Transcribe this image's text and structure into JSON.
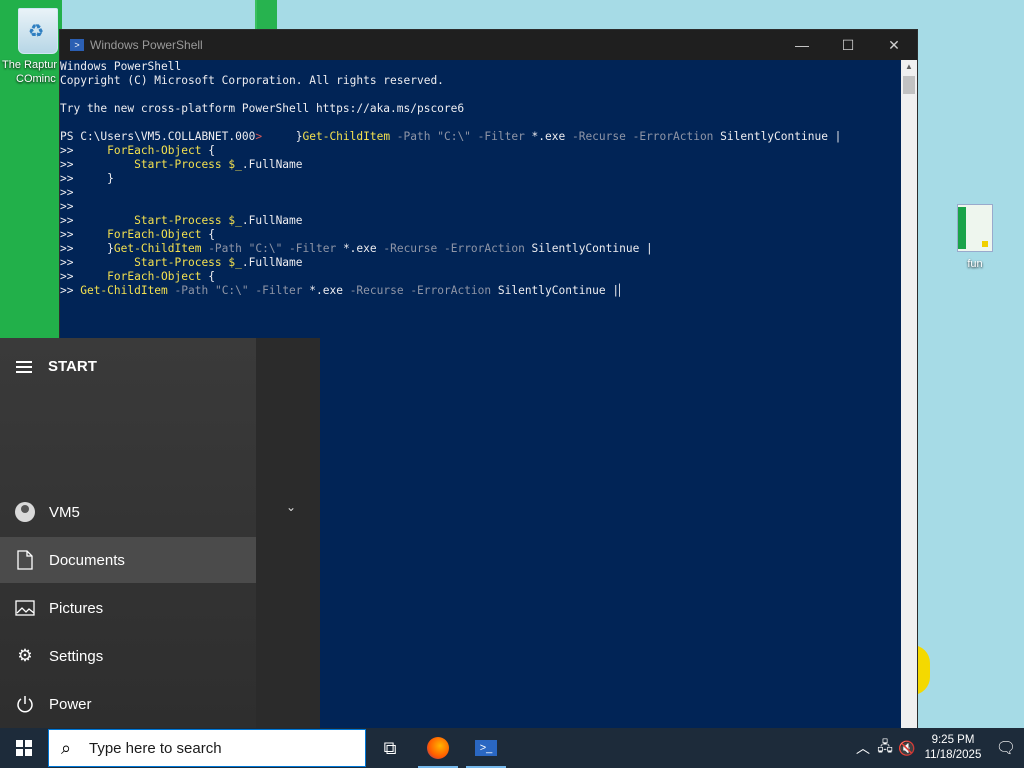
{
  "desktop": {
    "icons": [
      {
        "label_line1": "The Raptur",
        "label_line2": "COminc"
      },
      {
        "label": "fun"
      }
    ]
  },
  "powershell": {
    "title": "Windows PowerShell",
    "controls": {
      "minimize": "—",
      "maximize": "☐",
      "close": "✕"
    },
    "lines": [
      "Windows PowerShell",
      "Copyright (C) Microsoft Corporation. All rights reserved.",
      "",
      "Try the new cross-platform PowerShell https://aka.ms/pscore6",
      "",
      "PS C:\\Users\\VM5.COLLABNET.000>     }Get-ChildItem -Path \"C:\\\" -Filter *.exe -Recurse -ErrorAction SilentlyContinue |",
      ">>     ForEach-Object {",
      ">>         Start-Process $_.FullName",
      ">>     }",
      ">>",
      ">>",
      ">>         Start-Process $_.FullName",
      ">>     ForEach-Object {",
      ">>     }Get-ChildItem -Path \"C:\\\" -Filter *.exe -Recurse -ErrorAction SilentlyContinue |",
      ">>         Start-Process $_.FullName",
      ">>     ForEach-Object {",
      ">> Get-ChildItem -Path \"C:\\\" -Filter *.exe -Recurse -ErrorAction SilentlyContinue |"
    ]
  },
  "start_menu": {
    "header": "START",
    "items": [
      {
        "label": "VM5",
        "icon": "user-avatar-icon"
      },
      {
        "label": "Documents",
        "icon": "document-icon"
      },
      {
        "label": "Pictures",
        "icon": "pictures-icon"
      },
      {
        "label": "Settings",
        "icon": "gear-icon"
      },
      {
        "label": "Power",
        "icon": "power-icon"
      }
    ]
  },
  "taskbar": {
    "search_placeholder": "Type here to search",
    "time": "9:25 PM",
    "date": "11/18/2025"
  }
}
